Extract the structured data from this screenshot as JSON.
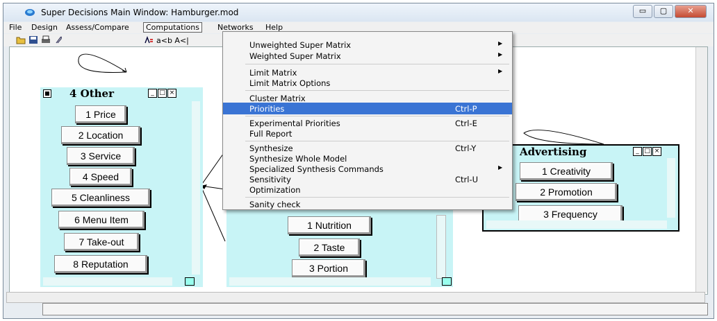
{
  "window": {
    "title": "Super Decisions Main Window: Hamburger.mod",
    "controls": [
      "minimize-icon",
      "maximize-icon",
      "close-icon"
    ],
    "close_glyph": "✕",
    "min_glyph": "▭",
    "max_glyph": "▢"
  },
  "menubar": {
    "items": [
      "File",
      "Design",
      "Assess/Compare",
      "Computations",
      "Networks",
      "Help"
    ],
    "active": "Computations"
  },
  "toolbar": {
    "icons": [
      "open-folder-icon",
      "save-icon",
      "print-icon",
      "paperclip-icon",
      "sort-icon"
    ],
    "text": "a<b A<|"
  },
  "computations_menu": {
    "items": [
      {
        "label": "Unweighted Super Matrix",
        "shortcut": "",
        "submenu": true
      },
      {
        "label": "Weighted Super Matrix",
        "shortcut": "",
        "submenu": true
      },
      {
        "label": "Limit Matrix",
        "shortcut": "",
        "submenu": true
      },
      {
        "label": "Limit Matrix Options",
        "shortcut": "",
        "submenu": false
      },
      {
        "label": "Cluster Matrix",
        "shortcut": "",
        "submenu": false
      },
      {
        "label": "Priorities",
        "shortcut": "Ctrl-P",
        "submenu": false,
        "highlighted": true
      },
      {
        "label": "Experimental Priorities",
        "shortcut": "Ctrl-E",
        "submenu": false
      },
      {
        "label": "Full Report",
        "shortcut": "",
        "submenu": false
      },
      {
        "label": "Synthesize",
        "shortcut": "Ctrl-Y",
        "submenu": false
      },
      {
        "label": "Synthesize Whole Model",
        "shortcut": "",
        "submenu": false
      },
      {
        "label": "Specialized Synthesis Commands",
        "shortcut": "",
        "submenu": true
      },
      {
        "label": "Sensitivity",
        "shortcut": "Ctrl-U",
        "submenu": false
      },
      {
        "label": "Optimization",
        "shortcut": "",
        "submenu": false
      },
      {
        "label": "Sanity check",
        "shortcut": "",
        "submenu": false
      }
    ],
    "arrow_glyph": "▶",
    "highlight_color": "#3a74d4"
  },
  "clusters": {
    "other": {
      "title": "4 Other",
      "nodes": [
        "1 Price",
        "2 Location",
        "3 Service",
        "4 Speed",
        "5 Cleanliness",
        "6 Menu Item",
        "7 Take-out",
        "8 Reputation"
      ]
    },
    "food": {
      "title": "",
      "nodes": [
        "1 Nutrition",
        "2 Taste",
        "3 Portion"
      ]
    },
    "advertising": {
      "title": "Advertising",
      "nodes": [
        "1 Creativity",
        "2 Promotion",
        "3 Frequency"
      ]
    }
  },
  "colors": {
    "cluster_bg": "#c8f4f6",
    "canvas_bg": "#ffffff"
  }
}
